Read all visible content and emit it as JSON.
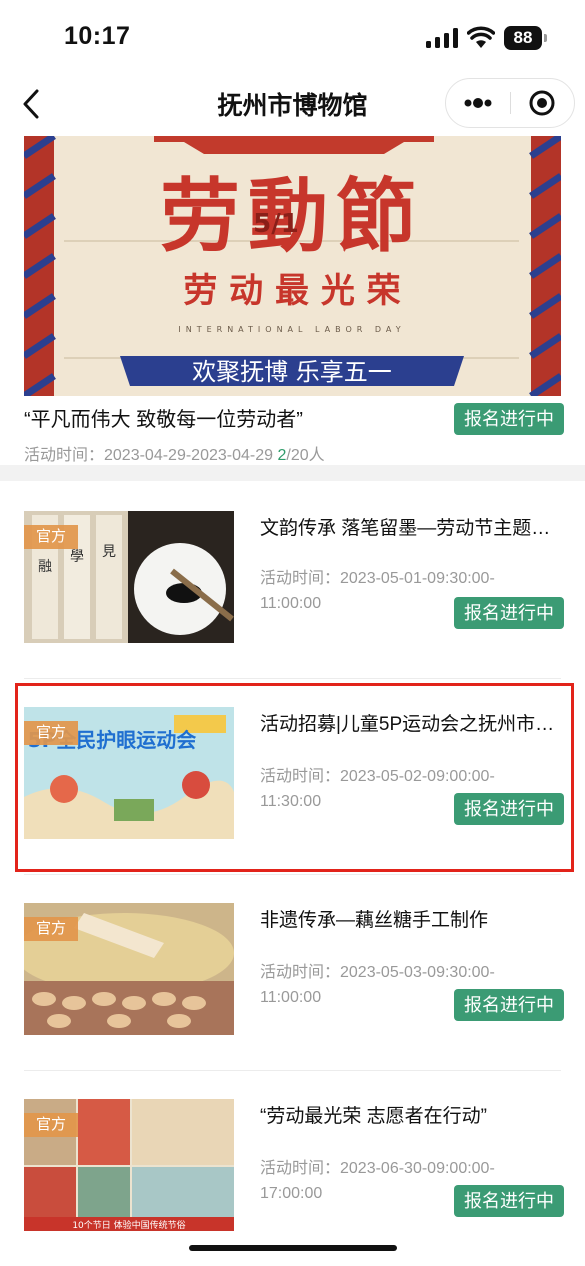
{
  "status": {
    "time": "10:17",
    "battery": "88"
  },
  "nav": {
    "title": "抚州市博物馆"
  },
  "featured": {
    "banner": {
      "date": "5/1",
      "headline": "劳動節",
      "subline": "劳 动 最 光 荣",
      "english": "INTERNATIONAL LABOR DAY",
      "ribbon": "欢聚抚博 乐享五一"
    },
    "title": "“平凡而伟大 致敬每一位劳动者”",
    "time_label": "活动时间：2023-04-29-2023-04-29 ",
    "count_current": "2",
    "count_total": "/20人",
    "badge": "报名进行中"
  },
  "list": {
    "items": [
      {
        "tag": "官方",
        "title": "文韵传承 落笔留墨—劳动节主题…",
        "time": "活动时间：2023-05-01-09:30:00-11:00:00",
        "badge": "报名进行中"
      },
      {
        "tag": "官方",
        "title": "活动招募|儿童5P运动会之抚州市…",
        "time": "活动时间：2023-05-02-09:00:00-11:30:00",
        "badge": "报名进行中",
        "thumb_text": "5P全民护眼运动会"
      },
      {
        "tag": "官方",
        "title": "非遗传承—藕丝糖手工制作",
        "time": "活动时间：2023-05-03-09:30:00-11:00:00",
        "badge": "报名进行中"
      },
      {
        "tag": "官方",
        "title": "“劳动最光荣 志愿者在行动”",
        "time": "活动时间：2023-06-30-09:00:00-17:00:00",
        "badge": "报名进行中",
        "thumb_text": "10个节日 体验中国传统节俗"
      }
    ]
  },
  "colors": {
    "badge": "#3b9b74",
    "tag": "#e2964b",
    "highlight": "#e2231a",
    "muted": "#999999"
  },
  "icons": [
    "signal-icon",
    "wifi-icon",
    "battery-icon",
    "back-arrow-icon",
    "more-dots-icon",
    "target-icon"
  ]
}
